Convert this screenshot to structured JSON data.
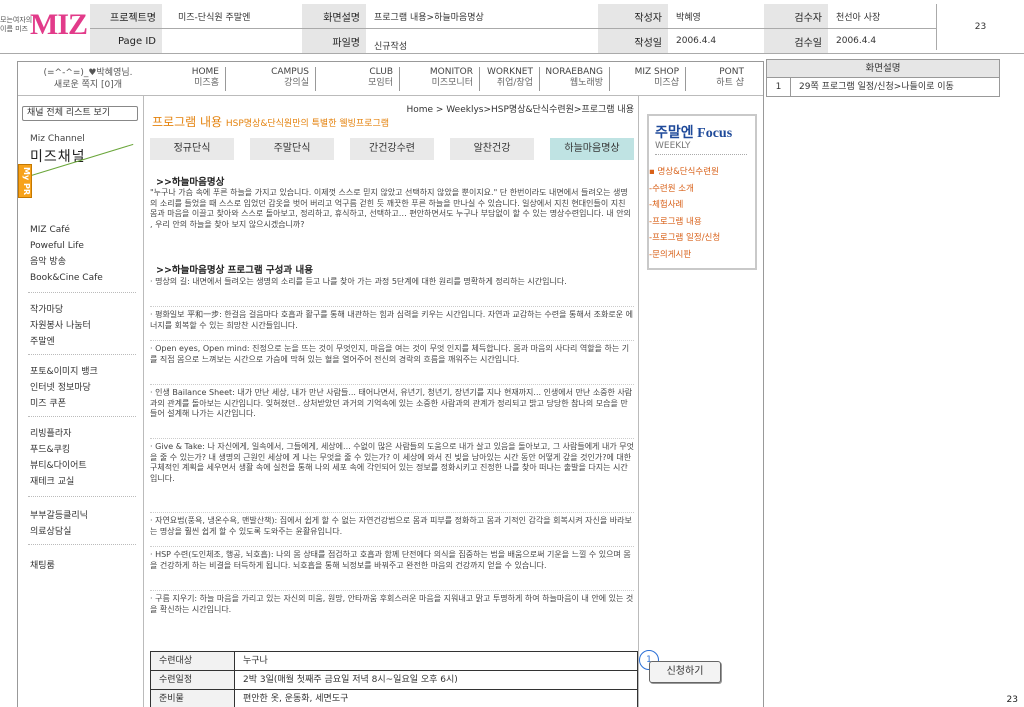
{
  "header": {
    "logo_mini": "모는여자의",
    "logo_mini2": "이름 미즈",
    "logo_big": "MIZ",
    "project_label": "프로젝트명",
    "project_value": "미즈-단식원 주말엔",
    "screen_desc_label": "화면설명",
    "screen_desc_value": "프로그램 내용>하늘마음명상",
    "author_label": "작성자",
    "author_value": "박혜영",
    "reviewer_label": "검수자",
    "reviewer_value": "천선아 사장",
    "page_number": "23",
    "page_id_label": "Page ID",
    "file_label": "파일명",
    "file_value": "신규작성",
    "date_label": "작성일",
    "date_value": "2006.4.4",
    "review_date_label": "검수일",
    "review_date_value": "2006.4.4"
  },
  "greeting": {
    "line1": "(=^-^=)_♥박혜영님.",
    "line2": "새로운 쪽지 [0]개"
  },
  "nav": [
    {
      "en": "HOME",
      "ko": "미즈홈"
    },
    {
      "en": "CAMPUS",
      "ko": "강의실"
    },
    {
      "en": "CLUB",
      "ko": "모임터"
    },
    {
      "en": "MONITOR",
      "ko": "미즈모니터"
    },
    {
      "en": "WORKNET",
      "ko": "취업/창업"
    },
    {
      "en": "NORAEBANG",
      "ko": "웹노래방"
    },
    {
      "en": "MIZ SHOP",
      "ko": "미즈샵"
    },
    {
      "en": "PONT",
      "ko": "하트 샵"
    }
  ],
  "my_pr": "My PR",
  "sidebar": {
    "list_all": "채널 전체 리스트 보기",
    "channel_sub": "Miz Channel",
    "channel_title": "미즈채널",
    "group1": [
      "MIZ Café",
      "Poweful Life",
      "음악 방송",
      "Book&Cine Cafe"
    ],
    "group2": [
      "작가마당",
      "자원봉사 나눔터",
      "주말엔"
    ],
    "group3": [
      "포토&이미지 뱅크",
      "인터넷 정보마당",
      "미즈 쿠폰"
    ],
    "group4": [
      "리빙플라자",
      "푸드&쿠킹",
      "뷰티&다이어트",
      "재테크 교실"
    ],
    "group5": [
      "부부갈등클리닉",
      "의료상담실"
    ],
    "group6": [
      "채팅룸"
    ]
  },
  "main": {
    "breadcrumb": "Home > Weeklys>HSP명상&단식수련원>프로그램 내용",
    "title": "프로그램 내용",
    "title_sub": "HSP명상&단식원만의 특별한 웰빙프로그램",
    "tabs": [
      "정규단식",
      "주말단식",
      "간건강수련",
      "알찬건강",
      "하늘마음명상"
    ],
    "section1": ">>하늘마음명상",
    "intro": "\"누구나 가슴 속에 푸른 하늘을 가지고 있습니다. 이제껏 스스로 믿지 않았고 선택하지 않았을 뿐이지요.\" 단 한번이라도 내면에서 들려오는 생명의 소리를 들었을 때 스스로 입었던 갑옷을 벗어 버리고 억구름 걷힌 듯 깨끗한 푸른 하늘을 만나실 수 있습니다. 일상에서 지친 현대인들이 지친 몸과 마음을 이끌고 찾아와 스스로 돌아보고, 정리하고, 휴식하고, 선택하고… 편안하면서도 누구나 부담없이 할 수 있는 명상수련입니다. 내 안의 , 우리 안의 하늘을 찾아 보지 않으시겠습니까?",
    "section2": ">>하늘마음명상 프로그램 구성과 내용",
    "items": [
      "· 명상의 길: 내면에서 들려오는 생명의 소리를 듣고 나를 찾아 가는 과정 5단계에 대한 원리를 명확하게 정리하는 시간입니다.",
      "· 평화일보 平和一步: 한걸음 걸음마다 호흡과 활구를 통해 내관하는 힘과 심력을 키우는 시간입니다. 자연과 교감하는 수련을 통해서 조화로운 에너지를 회복할 수 있는 희망찬 시간들입니다.",
      "· Open eyes, Open mind: 진정으로 눈을 뜨는 것이 무엇인지, 마음을 여는 것이 무엇 인지를 체득합니다. 몸과 마음의 사다리 역할을 하는 기를 직접 몸으로 느껴보는 시간으로 가슴에 막혀 있는 혈을 열어주어 전신의 경락의 흐름을 깨워주는 시간입니다.",
      "· 인생 Bailance Sheet: 내가 만난 세상, 내가 만난 사람들... 태어나면서, 유년기, 청년기, 장년기를 지나 현재까지... 인생에서 만난 소중한 사람과의 관계를 돌아보는 시간입니다. 잊혀졌던.. 상처받았던 과거의 기억속에 있는 소중한 사람과의 관계가 정리되고 밝고 당당한 참나의 모습을 만들어 설계해 나가는 시간입니다.",
      "· Give & Take: 나 자신에게, 일속에서, 그들에게, 세상에... 수없이 많은 사람들의 도움으로 내가 살고 있음을 돌아보고, 그 사람들에게 내가 무엇을 줄 수 있는가? 내 생명의 근원인 세상에 게 나는 무엇을 줄 수 있는가? 이 세상에 와서 진 빚을 남아있는 시간 동안 어떻게 갚을 것인가?에 대한 구체적인 계획을 세우면서 생활 속에 실천을 통해 나의 세포 속에 각인되어 있는 정보를 정화시키고 진정한 나를 찾아 떠나는 출발을 다지는 시간입니다.",
      "· 자연요법(풍욕, 냉온수욕, 맨발산책): 집에서 쉽게 할 수 없는 자연건강법으로 몸과 피부를 정화하고 몸과 기적인 감각을 회복시켜 자신을 바라보는 명상을 훨씬 쉽게 할 수 있도록 도와주는 윤활유입니다.",
      "· HSP 수련(도인체조, 행공, 뇌호흡): 나의 몸 상태를 점검하고 호흡과 함께 단전에다 의식을 집중하는 법을 배움으로써 기운을 느낄 수 있으며 몸을 건강하게 하는 비결을 터득하게 됩니다. 뇌호흡을 통해 뇌정보를 바꿔주고 완전한 마음의 건강까지 얻을 수 있습니다.",
      "· 구름 지우기: 하늘 마음을 가리고 있는 자신의 미움, 원망, 안타까움 후회스러운 마음을 지워내고 맑고 투명하게 하여 하늘마음이 내 안에 있는 것을 확신하는 시간입니다."
    ],
    "info": [
      {
        "k": "수련대상",
        "v": "누구나"
      },
      {
        "k": "수련일정",
        "v": "2박 3일(매월 첫째주 금요일 저녁 8시~일요일 오후 6시)"
      },
      {
        "k": "준비물",
        "v": "편안한 옷, 운동화, 세면도구"
      }
    ]
  },
  "focus": {
    "title": "주말엔 Focus",
    "sub": "WEEKLY",
    "items": [
      "▪ 명상&단식수련원",
      "-수련원 소개",
      "-체험사례",
      "-프로그램 내용",
      "-프로그램 일정/신청",
      "-문의게시판"
    ],
    "apply": "신청하기",
    "badge": "1"
  },
  "desc": {
    "header": "화면설명",
    "rows": [
      {
        "n": "1",
        "t": "29쪽 프로그램 일정/신청>나들이로 이동"
      }
    ]
  },
  "page_footer": "23"
}
